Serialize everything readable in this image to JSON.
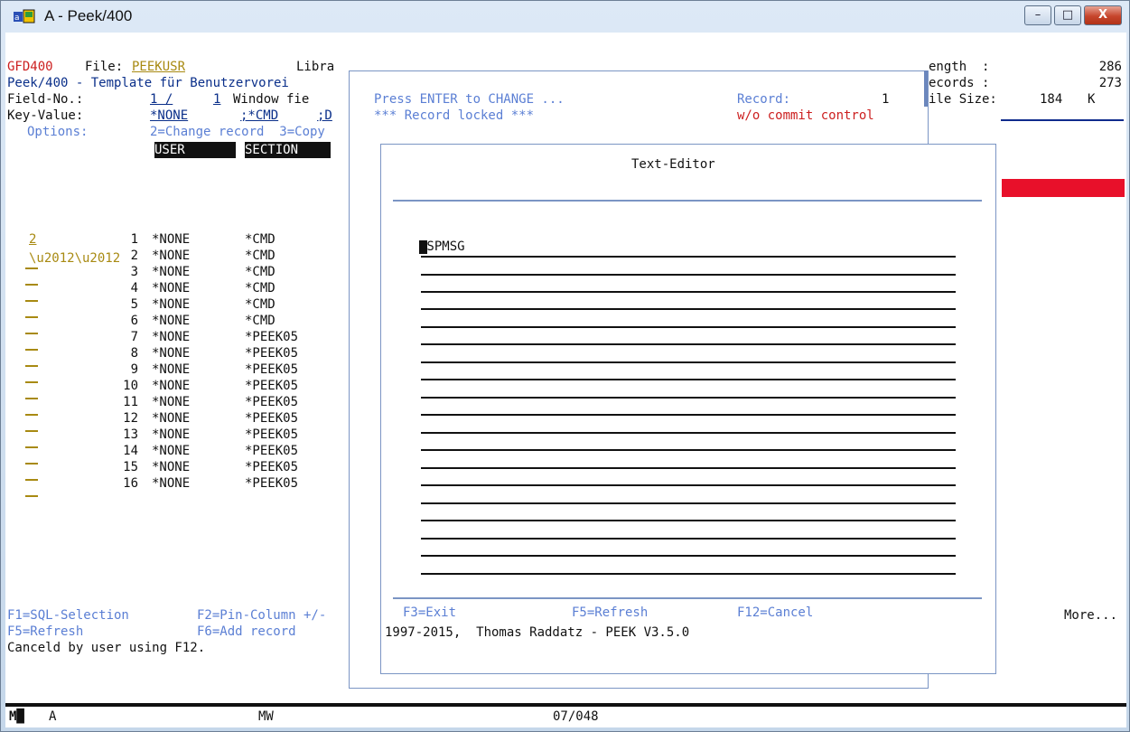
{
  "window": {
    "title": "A - Peek/400",
    "minimize": "–",
    "maximize": "□",
    "close": "X"
  },
  "header": {
    "program": "GFD400",
    "file_label": "File:",
    "file_name": "PEEKUSR",
    "library_label": "Libra",
    "template_text": "Peek/400 - Template für Benutzervorei",
    "field_no_label": "Field-No.:",
    "field_no_value": "1 /",
    "window_no": "1",
    "window_label": "Window fie",
    "key_label": "Key-Value:",
    "key1": "*NONE",
    "key2": ";*CMD",
    "key3": ";D",
    "options_label": "Options:",
    "options_text": "2=Change record  3=Copy",
    "col_user": "USER",
    "col_section": "SECTION"
  },
  "right_info": {
    "length_label": "ength  :",
    "length_value": "286",
    "records_label": "ecords :",
    "records_value": "273",
    "filesize_label": "ile Size:",
    "filesize_value": "184",
    "filesize_unit": "K",
    "more": "More..."
  },
  "popup": {
    "press_enter": "Press ENTER to CHANGE ...",
    "record_label": "Record:",
    "record_value": "1",
    "locked": "*** Record locked ***",
    "commit": "w/o commit control"
  },
  "editor": {
    "title": "Text-Editor",
    "first_line": "DSPMSG",
    "f3": "F3=Exit",
    "f5": "F5=Refresh",
    "f12": "F12=Cancel",
    "copyright": "1997-2015,  Thomas Raddatz - PEEK V3.5.0"
  },
  "rows": [
    {
      "opt": "2",
      "num": "1",
      "user": "*NONE",
      "section": "*CMD"
    },
    {
      "opt": "",
      "num": "2",
      "user": "*NONE",
      "section": "*CMD"
    },
    {
      "opt": "",
      "num": "3",
      "user": "*NONE",
      "section": "*CMD"
    },
    {
      "opt": "",
      "num": "4",
      "user": "*NONE",
      "section": "*CMD"
    },
    {
      "opt": "",
      "num": "5",
      "user": "*NONE",
      "section": "*CMD"
    },
    {
      "opt": "",
      "num": "6",
      "user": "*NONE",
      "section": "*CMD"
    },
    {
      "opt": "",
      "num": "7",
      "user": "*NONE",
      "section": "*PEEK05"
    },
    {
      "opt": "",
      "num": "8",
      "user": "*NONE",
      "section": "*PEEK05"
    },
    {
      "opt": "",
      "num": "9",
      "user": "*NONE",
      "section": "*PEEK05"
    },
    {
      "opt": "",
      "num": "10",
      "user": "*NONE",
      "section": "*PEEK05"
    },
    {
      "opt": "",
      "num": "11",
      "user": "*NONE",
      "section": "*PEEK05"
    },
    {
      "opt": "",
      "num": "12",
      "user": "*NONE",
      "section": "*PEEK05"
    },
    {
      "opt": "",
      "num": "13",
      "user": "*NONE",
      "section": "*PEEK05"
    },
    {
      "opt": "",
      "num": "14",
      "user": "*NONE",
      "section": "*PEEK05"
    },
    {
      "opt": "",
      "num": "15",
      "user": "*NONE",
      "section": "*PEEK05"
    },
    {
      "opt": "",
      "num": "16",
      "user": "*NONE",
      "section": "*PEEK05"
    }
  ],
  "footer": {
    "f1": "F1=SQL-Selection",
    "f2": "F2=Pin-Column +/-",
    "f5": "F5=Refresh",
    "f6": "F6=Add record",
    "message": "Canceld by user using F12."
  },
  "status": {
    "session": "A",
    "mode": "MW",
    "cursor_pos": "07/048"
  },
  "colors": {
    "accent_red": "#e8102a",
    "text_blue": "#0f2b8c",
    "light_blue": "#5b7fd4"
  }
}
